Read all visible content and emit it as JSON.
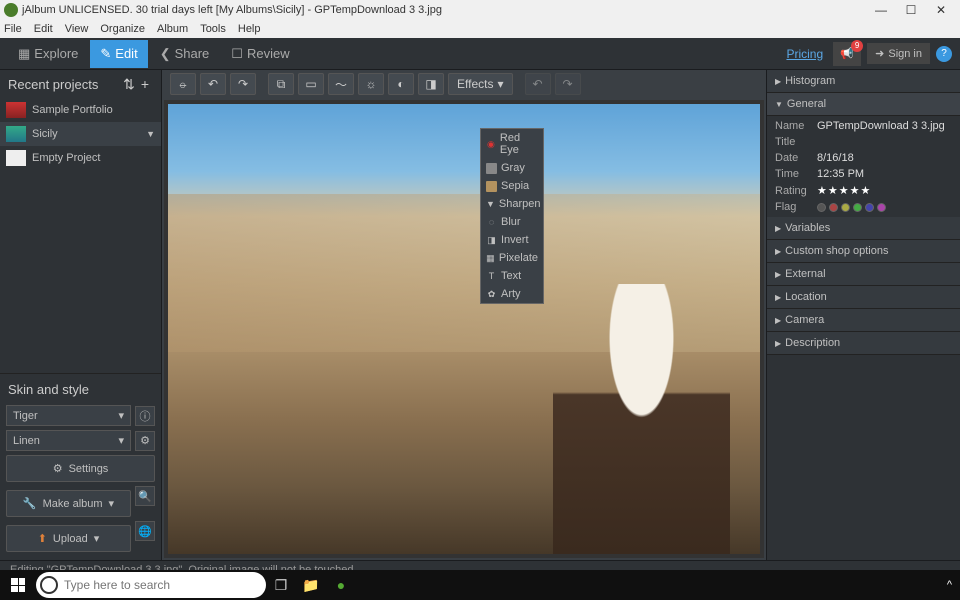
{
  "window": {
    "title": "jAlbum UNLICENSED. 30 trial days left [My Albums\\Sicily] - GPTempDownload 3 3.jpg"
  },
  "menu": [
    "File",
    "Edit",
    "View",
    "Organize",
    "Album",
    "Tools",
    "Help"
  ],
  "topbar": {
    "explore": "Explore",
    "edit": "Edit",
    "share": "Share",
    "review": "Review",
    "pricing": "Pricing",
    "signin": "Sign in",
    "notif_count": "9"
  },
  "sidebar": {
    "header": "Recent projects",
    "projects": [
      {
        "name": "Sample Portfolio"
      },
      {
        "name": "Sicily"
      },
      {
        "name": "Empty Project"
      }
    ]
  },
  "skin": {
    "header": "Skin and style",
    "theme": "Tiger",
    "style": "Linen",
    "settings": "Settings",
    "make_album": "Make album",
    "upload": "Upload"
  },
  "edit_toolbar": {
    "effects_label": "Effects"
  },
  "effects_menu": [
    "Red Eye",
    "Gray",
    "Sepia",
    "Sharpen",
    "Blur",
    "Invert",
    "Pixelate",
    "Text",
    "Arty"
  ],
  "panels": {
    "histogram": "Histogram",
    "general": "General",
    "variables": "Variables",
    "custom_shop": "Custom shop options",
    "external": "External",
    "location": "Location",
    "camera": "Camera",
    "description": "Description"
  },
  "general": {
    "name_label": "Name",
    "name_val": "GPTempDownload 3 3.jpg",
    "title_label": "Title",
    "title_val": "",
    "date_label": "Date",
    "date_val": "8/16/18",
    "time_label": "Time",
    "time_val": "12:35 PM",
    "rating_label": "Rating",
    "flag_label": "Flag"
  },
  "status": "Editing \"GPTempDownload 3 3.jpg\". Original image will not be touched",
  "taskbar": {
    "search_placeholder": "Type here to search"
  }
}
